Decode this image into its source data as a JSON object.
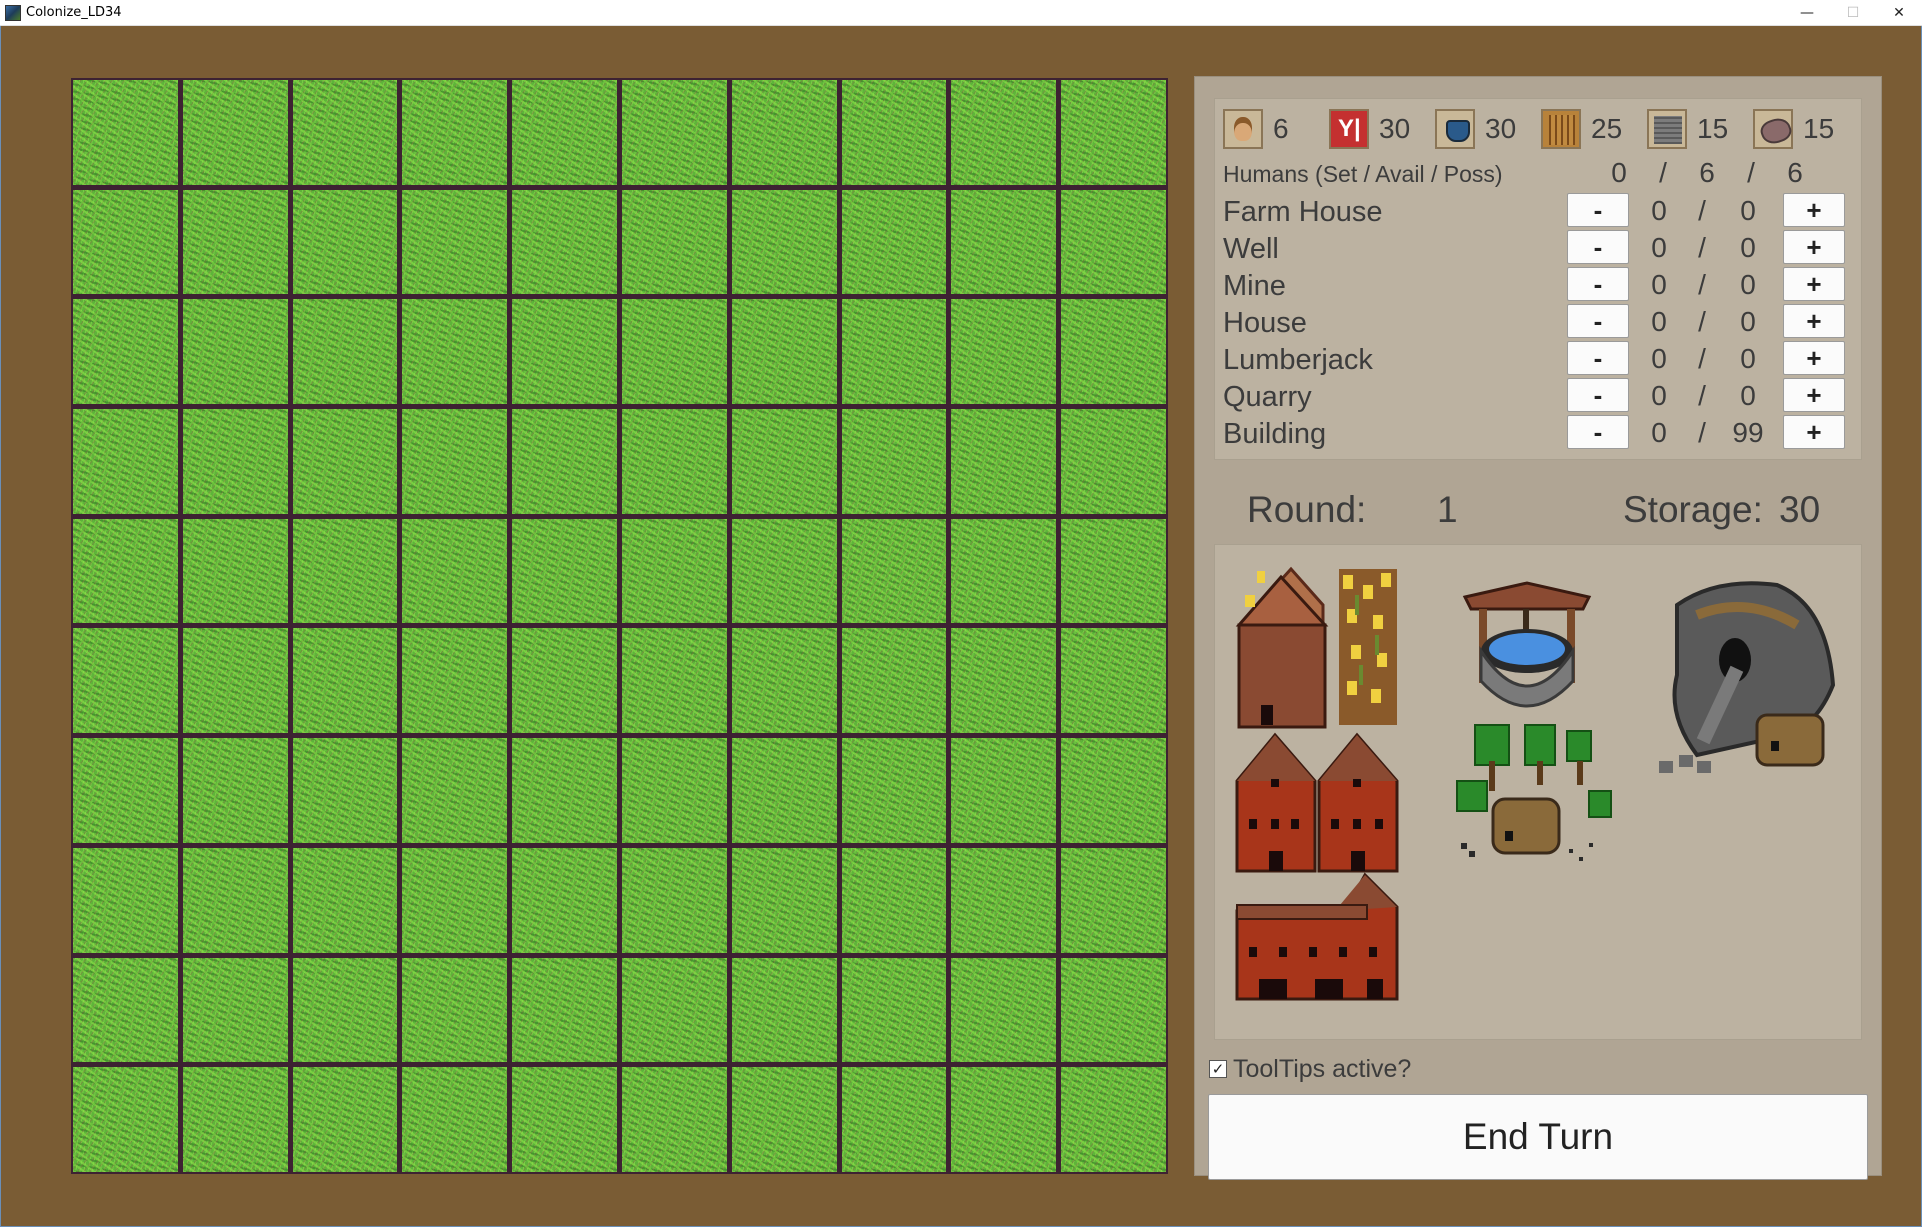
{
  "window": {
    "title": "Colonize_LD34",
    "minimize": "—",
    "maximize": "☐",
    "close": "✕"
  },
  "grid": {
    "rows": 10,
    "cols": 10
  },
  "resources": [
    {
      "name": "human-icon",
      "value": "6"
    },
    {
      "name": "food-icon",
      "value": "30"
    },
    {
      "name": "water-icon",
      "value": "30"
    },
    {
      "name": "wood-icon",
      "value": "25"
    },
    {
      "name": "stone-icon",
      "value": "15"
    },
    {
      "name": "ore-icon",
      "value": "15"
    }
  ],
  "humans": {
    "label": "Humans (Set / Avail / Poss)",
    "set": "0",
    "avail": "6",
    "poss": "6",
    "sep": "/"
  },
  "jobs": [
    {
      "label": "Farm House",
      "assigned": "0",
      "max": "0"
    },
    {
      "label": "Well",
      "assigned": "0",
      "max": "0"
    },
    {
      "label": "Mine",
      "assigned": "0",
      "max": "0"
    },
    {
      "label": "House",
      "assigned": "0",
      "max": "0"
    },
    {
      "label": "Lumberjack",
      "assigned": "0",
      "max": "0"
    },
    {
      "label": "Quarry",
      "assigned": "0",
      "max": "0"
    },
    {
      "label": "Building",
      "assigned": "0",
      "max": "99"
    }
  ],
  "buttons": {
    "minus": "-",
    "plus": "+",
    "sep": "/"
  },
  "round": {
    "label": "Round:",
    "value": "1"
  },
  "storage": {
    "label": "Storage:",
    "value": "30"
  },
  "buildings": [
    {
      "name": "farm-house-icon"
    },
    {
      "name": "well-icon"
    },
    {
      "name": "mine-icon"
    },
    {
      "name": "house-icon"
    },
    {
      "name": "lumberjack-icon"
    },
    {
      "name": "quarry-icon"
    },
    {
      "name": "storage-building-icon"
    }
  ],
  "tooltips": {
    "label": "ToolTips active?",
    "checked": true,
    "check": "✓"
  },
  "end_turn": {
    "label": "End Turn"
  }
}
